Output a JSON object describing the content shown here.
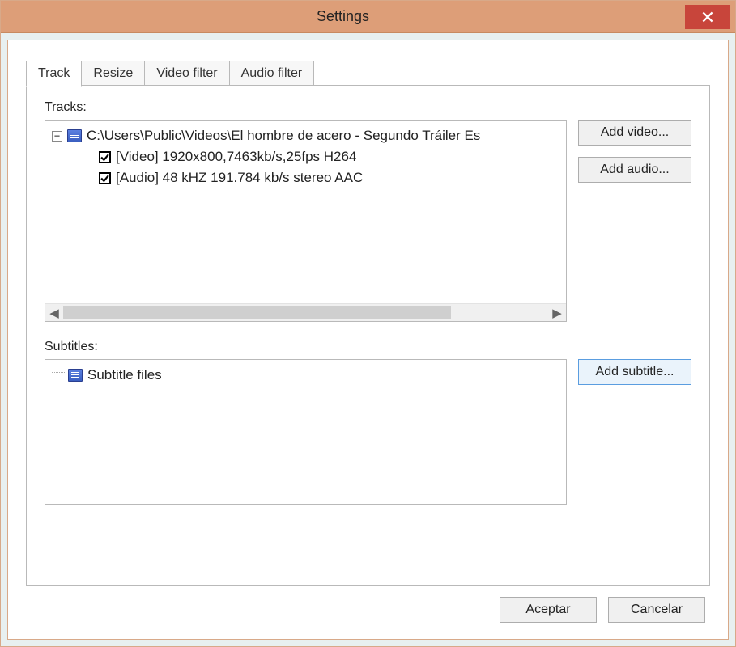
{
  "window": {
    "title": "Settings"
  },
  "tabs": [
    {
      "label": "Track"
    },
    {
      "label": "Resize"
    },
    {
      "label": "Video filter"
    },
    {
      "label": "Audio filter"
    }
  ],
  "active_tab": 0,
  "tracks": {
    "label": "Tracks:",
    "root": {
      "path": "C:\\Users\\Public\\Videos\\El hombre de acero - Segundo Tráiler Es",
      "expanded": true,
      "children": [
        {
          "checked": true,
          "text": "[Video] 1920x800,7463kb/s,25fps H264"
        },
        {
          "checked": true,
          "text": "[Audio] 48 kHZ 191.784 kb/s stereo AAC"
        }
      ]
    },
    "buttons": {
      "add_video": "Add video...",
      "add_audio": "Add audio..."
    }
  },
  "subtitles": {
    "label": "Subtitles:",
    "root_text": "Subtitle files",
    "button": "Add subtitle..."
  },
  "footer": {
    "ok": "Aceptar",
    "cancel": "Cancelar"
  },
  "icons": {
    "close": "close-icon",
    "file": "file-icon",
    "expander_minus": "−"
  }
}
